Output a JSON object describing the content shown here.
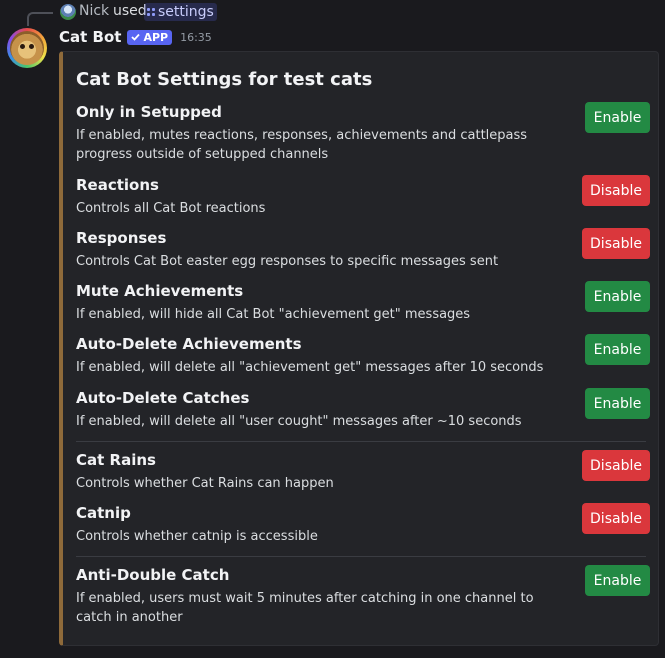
{
  "reply": {
    "user": "Nick",
    "used_text": "used",
    "command": "settings"
  },
  "message": {
    "author": "Cat Bot",
    "badge": "APP",
    "time": "16:35"
  },
  "embed": {
    "accent_color": "#8e6a3a",
    "title": "Cat Bot Settings for test cats",
    "settings": [
      {
        "title": "Only in Setupped",
        "desc": "If enabled, mutes reactions, responses, achievements and cattlepass progress outside of setupped channels",
        "button": "Enable"
      },
      {
        "title": "Reactions",
        "desc": "Controls all Cat Bot reactions",
        "button": "Disable"
      },
      {
        "title": "Responses",
        "desc": "Controls Cat Bot easter egg responses to specific messages sent",
        "button": "Disable"
      },
      {
        "title": "Mute Achievements",
        "desc": "If enabled, will hide all Cat Bot \"achievement get\" messages",
        "button": "Enable"
      },
      {
        "title": "Auto-Delete Achievements",
        "desc": "If enabled, will delete all \"achievement get\" messages after 10 seconds",
        "button": "Enable"
      },
      {
        "title": "Auto-Delete Catches",
        "desc": "If enabled, will delete all \"user cought\" messages after ~10 seconds",
        "button": "Enable"
      },
      {
        "title": "Cat Rains",
        "desc": "Controls whether Cat Rains can happen",
        "button": "Disable"
      },
      {
        "title": "Catnip",
        "desc": "Controls whether catnip is accessible",
        "button": "Disable"
      },
      {
        "title": "Anti-Double Catch",
        "desc": "If enabled, users must wait 5 minutes after catching in one channel to catch in another",
        "button": "Enable"
      }
    ]
  },
  "colors": {
    "enable": "#238a44",
    "disable": "#da373c",
    "badge": "#5865f2"
  }
}
